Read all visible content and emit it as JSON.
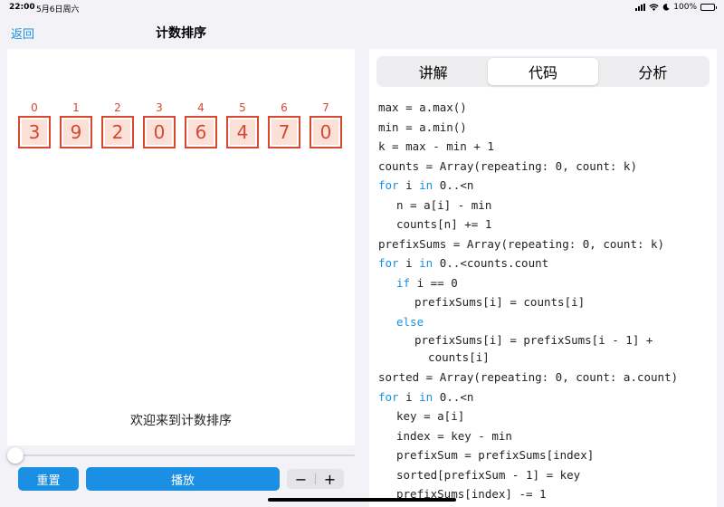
{
  "status_bar": {
    "time": "22:00",
    "date": "5月6日周六",
    "battery": "100%",
    "battery_level": 1.0
  },
  "nav": {
    "back_label": "返回",
    "title": "计数排序"
  },
  "array": {
    "indices": [
      "0",
      "1",
      "2",
      "3",
      "4",
      "5",
      "6",
      "7"
    ],
    "values": [
      "3",
      "9",
      "2",
      "0",
      "6",
      "4",
      "7",
      "0"
    ],
    "color": "#d9472f",
    "fill_color": "#fbe0d8"
  },
  "message": "欢迎来到计数排序",
  "slider": {
    "value": 0
  },
  "controls": {
    "reset_label": "重置",
    "play_label": "播放",
    "minus_label": "−",
    "plus_label": "+"
  },
  "tabs": [
    {
      "label": "讲解",
      "selected": false
    },
    {
      "label": "代码",
      "selected": true
    },
    {
      "label": "分析",
      "selected": false
    }
  ],
  "code_lines": [
    {
      "indent": 0,
      "parts": [
        {
          "t": "max = a.max()"
        }
      ]
    },
    {
      "indent": 0,
      "parts": [
        {
          "t": "min = a.min()"
        }
      ]
    },
    {
      "indent": 0,
      "parts": [
        {
          "t": "k = max - min + 1"
        }
      ]
    },
    {
      "indent": 0,
      "parts": [
        {
          "t": "counts = Array(repeating: 0, count: k)"
        }
      ]
    },
    {
      "indent": 0,
      "parts": [
        {
          "t": "for",
          "kw": true
        },
        {
          "t": " i "
        },
        {
          "t": "in",
          "kw": true
        },
        {
          "t": " 0..<n"
        }
      ]
    },
    {
      "indent": 1,
      "parts": [
        {
          "t": "n = a[i] - min"
        }
      ]
    },
    {
      "indent": 1,
      "parts": [
        {
          "t": "counts[n] += 1"
        }
      ]
    },
    {
      "indent": 0,
      "parts": [
        {
          "t": "prefixSums = Array(repeating: 0, count: k)"
        }
      ]
    },
    {
      "indent": 0,
      "parts": [
        {
          "t": "for",
          "kw": true
        },
        {
          "t": " i "
        },
        {
          "t": "in",
          "kw": true
        },
        {
          "t": " 0..<counts.count"
        }
      ]
    },
    {
      "indent": 1,
      "parts": [
        {
          "t": "if",
          "kw": true
        },
        {
          "t": " i == 0"
        }
      ]
    },
    {
      "indent": 2,
      "parts": [
        {
          "t": "prefixSums[i] = counts[i]"
        }
      ]
    },
    {
      "indent": 1,
      "parts": [
        {
          "t": "else",
          "kw": true
        }
      ]
    },
    {
      "indent": 2,
      "wrap": true,
      "parts": [
        {
          "t": "prefixSums[i] = prefixSums[i - 1] +\n  counts[i]"
        }
      ]
    },
    {
      "indent": 0,
      "parts": [
        {
          "t": "sorted = Array(repeating: 0, count: a.count)"
        }
      ]
    },
    {
      "indent": 0,
      "parts": [
        {
          "t": "for",
          "kw": true
        },
        {
          "t": " i "
        },
        {
          "t": "in",
          "kw": true
        },
        {
          "t": " 0..<n"
        }
      ]
    },
    {
      "indent": 1,
      "parts": [
        {
          "t": "key = a[i]"
        }
      ]
    },
    {
      "indent": 1,
      "parts": [
        {
          "t": "index = key - min"
        }
      ]
    },
    {
      "indent": 1,
      "parts": [
        {
          "t": "prefixSum = prefixSums[index]"
        }
      ]
    },
    {
      "indent": 1,
      "parts": [
        {
          "t": "sorted[prefixSum - 1] = key"
        }
      ]
    },
    {
      "indent": 1,
      "parts": [
        {
          "t": "prefixSums[index] -= 1"
        }
      ]
    }
  ],
  "colors": {
    "accent": "#1a8fe3",
    "keyword": "#1a8fe3",
    "background": "#f2f2f7"
  }
}
